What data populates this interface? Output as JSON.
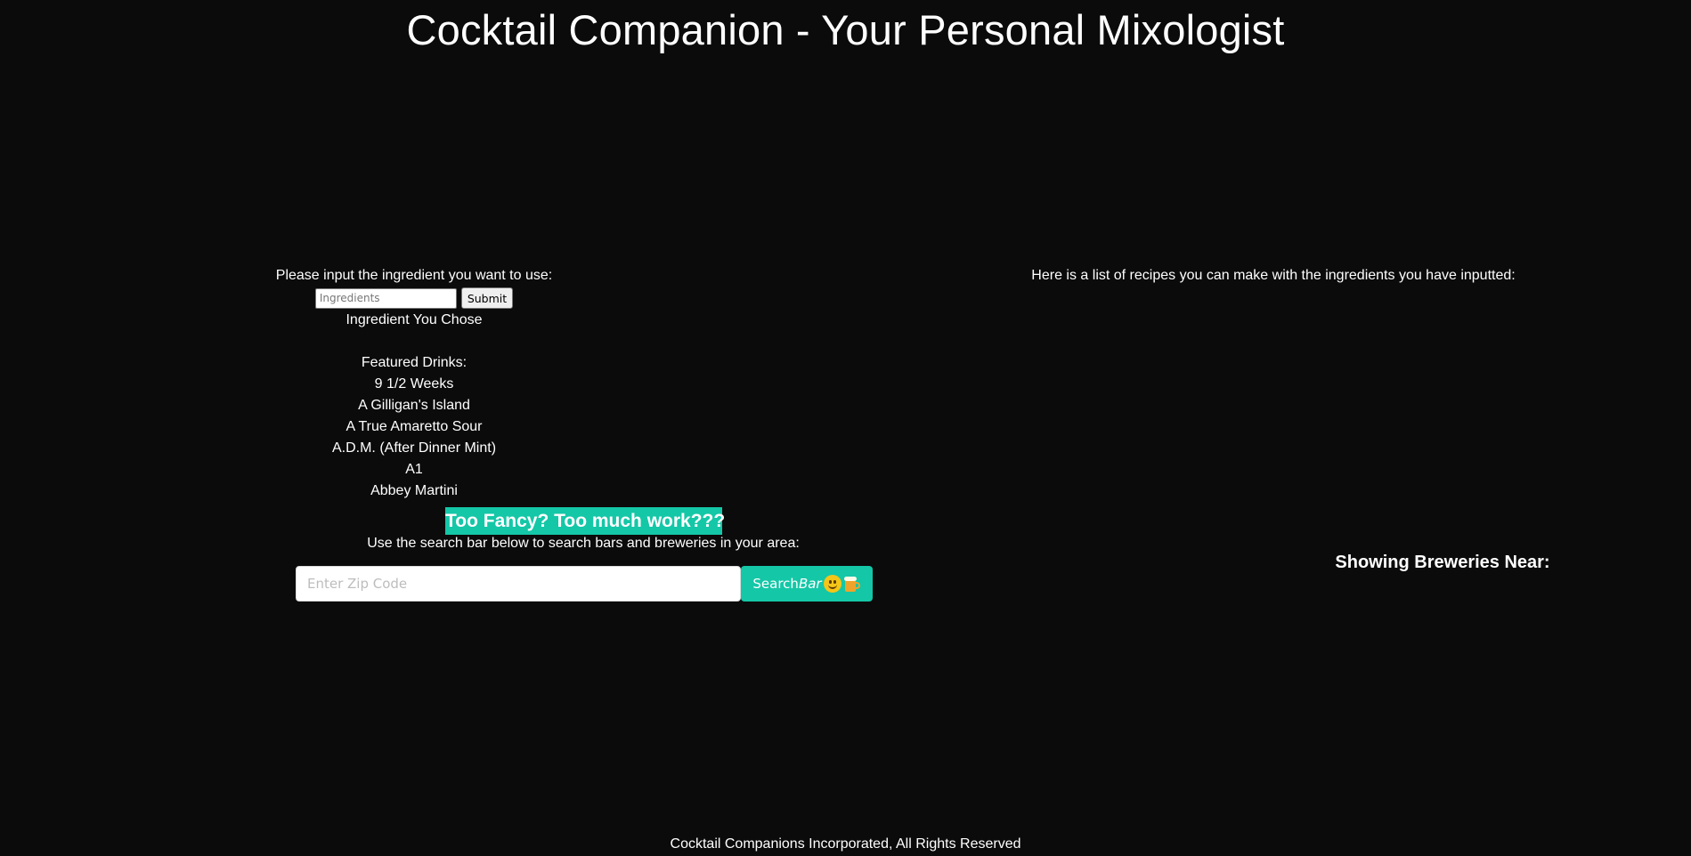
{
  "header": {
    "title": "Cocktail Companion - Your Personal Mixologist"
  },
  "ingredients": {
    "prompt": "Please input the ingredient you want to use:",
    "input_placeholder": "Ingredients",
    "submit_label": "Submit",
    "chosen_label": "Ingredient You Chose"
  },
  "featured": {
    "heading": "Featured Drinks:",
    "drinks": [
      "9 1/2 Weeks",
      "A Gilligan's Island",
      "A True Amaretto Sour",
      "A.D.M. (After Dinner Mint)",
      "A1",
      "Abbey Martini"
    ]
  },
  "bar_search": {
    "banner": "Too Fancy? Too much work???",
    "hint": "Use the search bar below to search bars and breweries in your area:",
    "zip_placeholder": "Enter Zip Code",
    "button_text": "Search",
    "button_italic": "Bar",
    "button_icons": [
      "winking-face-icon",
      "beer-mug-icon"
    ]
  },
  "recipes": {
    "heading": "Here is a list of recipes you can make with the ingredients you have inputted:"
  },
  "breweries": {
    "heading": "Showing Breweries Near:"
  },
  "footer": {
    "text": "Cocktail Companions Incorporated, All Rights Reserved"
  },
  "colors": {
    "background": "#0b0b0b",
    "accent": "#14c7a7",
    "text": "#ffffff"
  }
}
